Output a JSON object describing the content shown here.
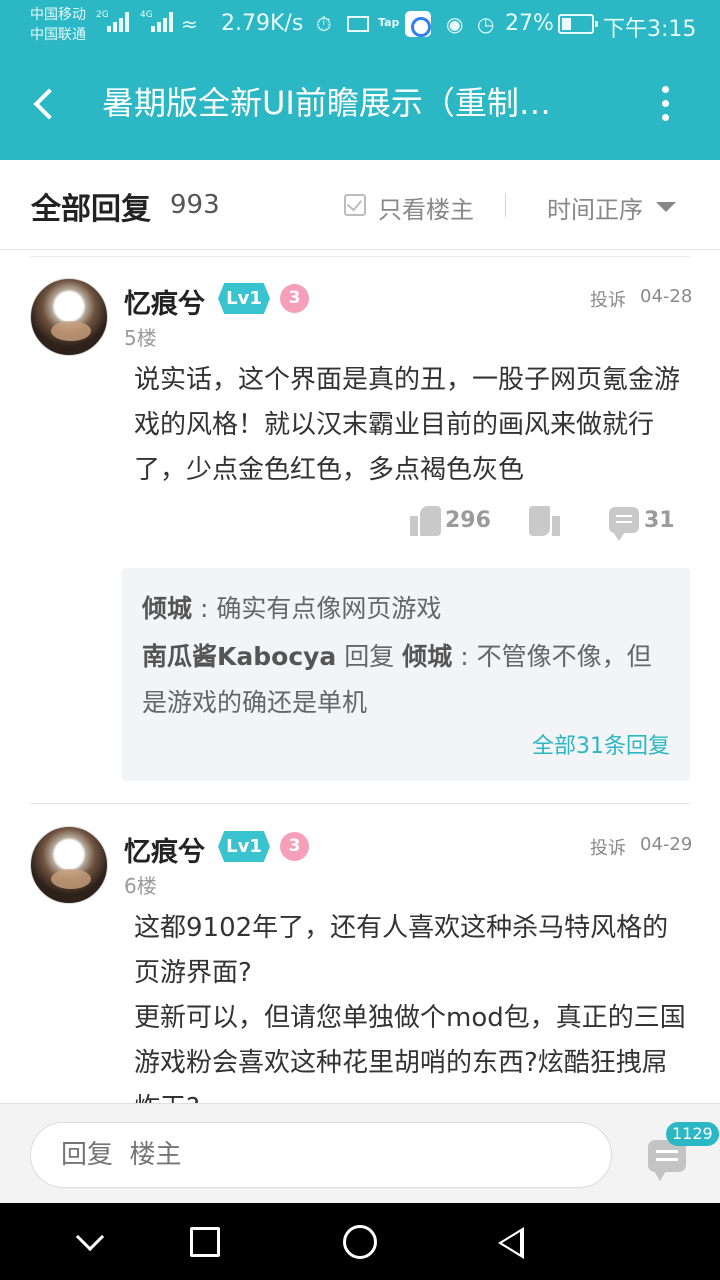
{
  "status_bar": {
    "carrier_1": "中国移动",
    "carrier_2": "中国联通",
    "net_1": "2G",
    "net_2": "4G",
    "speed": "2.79K/s",
    "tap_label": "Tap",
    "battery": "27%",
    "time": "下午3:15"
  },
  "header": {
    "title": "暑期版全新UI前瞻展示（重制…"
  },
  "filter_bar": {
    "all_replies_label": "全部回复",
    "reply_count": "993",
    "only_host_label": "只看楼主",
    "sort_label": "时间正序"
  },
  "posts": [
    {
      "author": "忆痕兮",
      "level": "Lv1",
      "rank": "3",
      "report_label": "投诉",
      "date": "04-28",
      "floor": "5楼",
      "content": "说实话，这个界面是真的丑，一股子网页氪金游戏的风格！就以汉末霸业目前的画风来做就行了，少点金色红色，多点褐色灰色",
      "likes": "296",
      "comments": "31",
      "sub_replies": [
        {
          "name": "倾城",
          "text": "确实有点像网页游戏"
        },
        {
          "name": "南瓜酱Kabocya",
          "reply_word": "回复",
          "reply_to": "倾城",
          "text": "不管像不像，但是游戏的确还是单机"
        }
      ],
      "more_replies_label": "全部31条回复"
    },
    {
      "author": "忆痕兮",
      "level": "Lv1",
      "rank": "3",
      "report_label": "投诉",
      "date": "04-29",
      "floor": "6楼",
      "content_line_1": "这都9102年了，还有人喜欢这种杀马特风格的页游界面?",
      "content_line_2": "更新可以，但请您单独做个mod包，真正的三国游戏粉会喜欢这种花里胡哨的东西?炫酷狂拽屌炸天?"
    }
  ],
  "reply_bar": {
    "placeholder": "回复  楼主",
    "badge_count": "1129"
  },
  "colors": {
    "accent": "#2bb7c4",
    "level_badge": "#38c3cf",
    "rank_badge": "#f5a0b8"
  },
  "icons": [
    "back-icon",
    "more-icon",
    "checkbox-icon",
    "caret-down-icon",
    "thumbs-up-icon",
    "thumbs-down-icon",
    "comment-icon",
    "comment-list-icon"
  ]
}
